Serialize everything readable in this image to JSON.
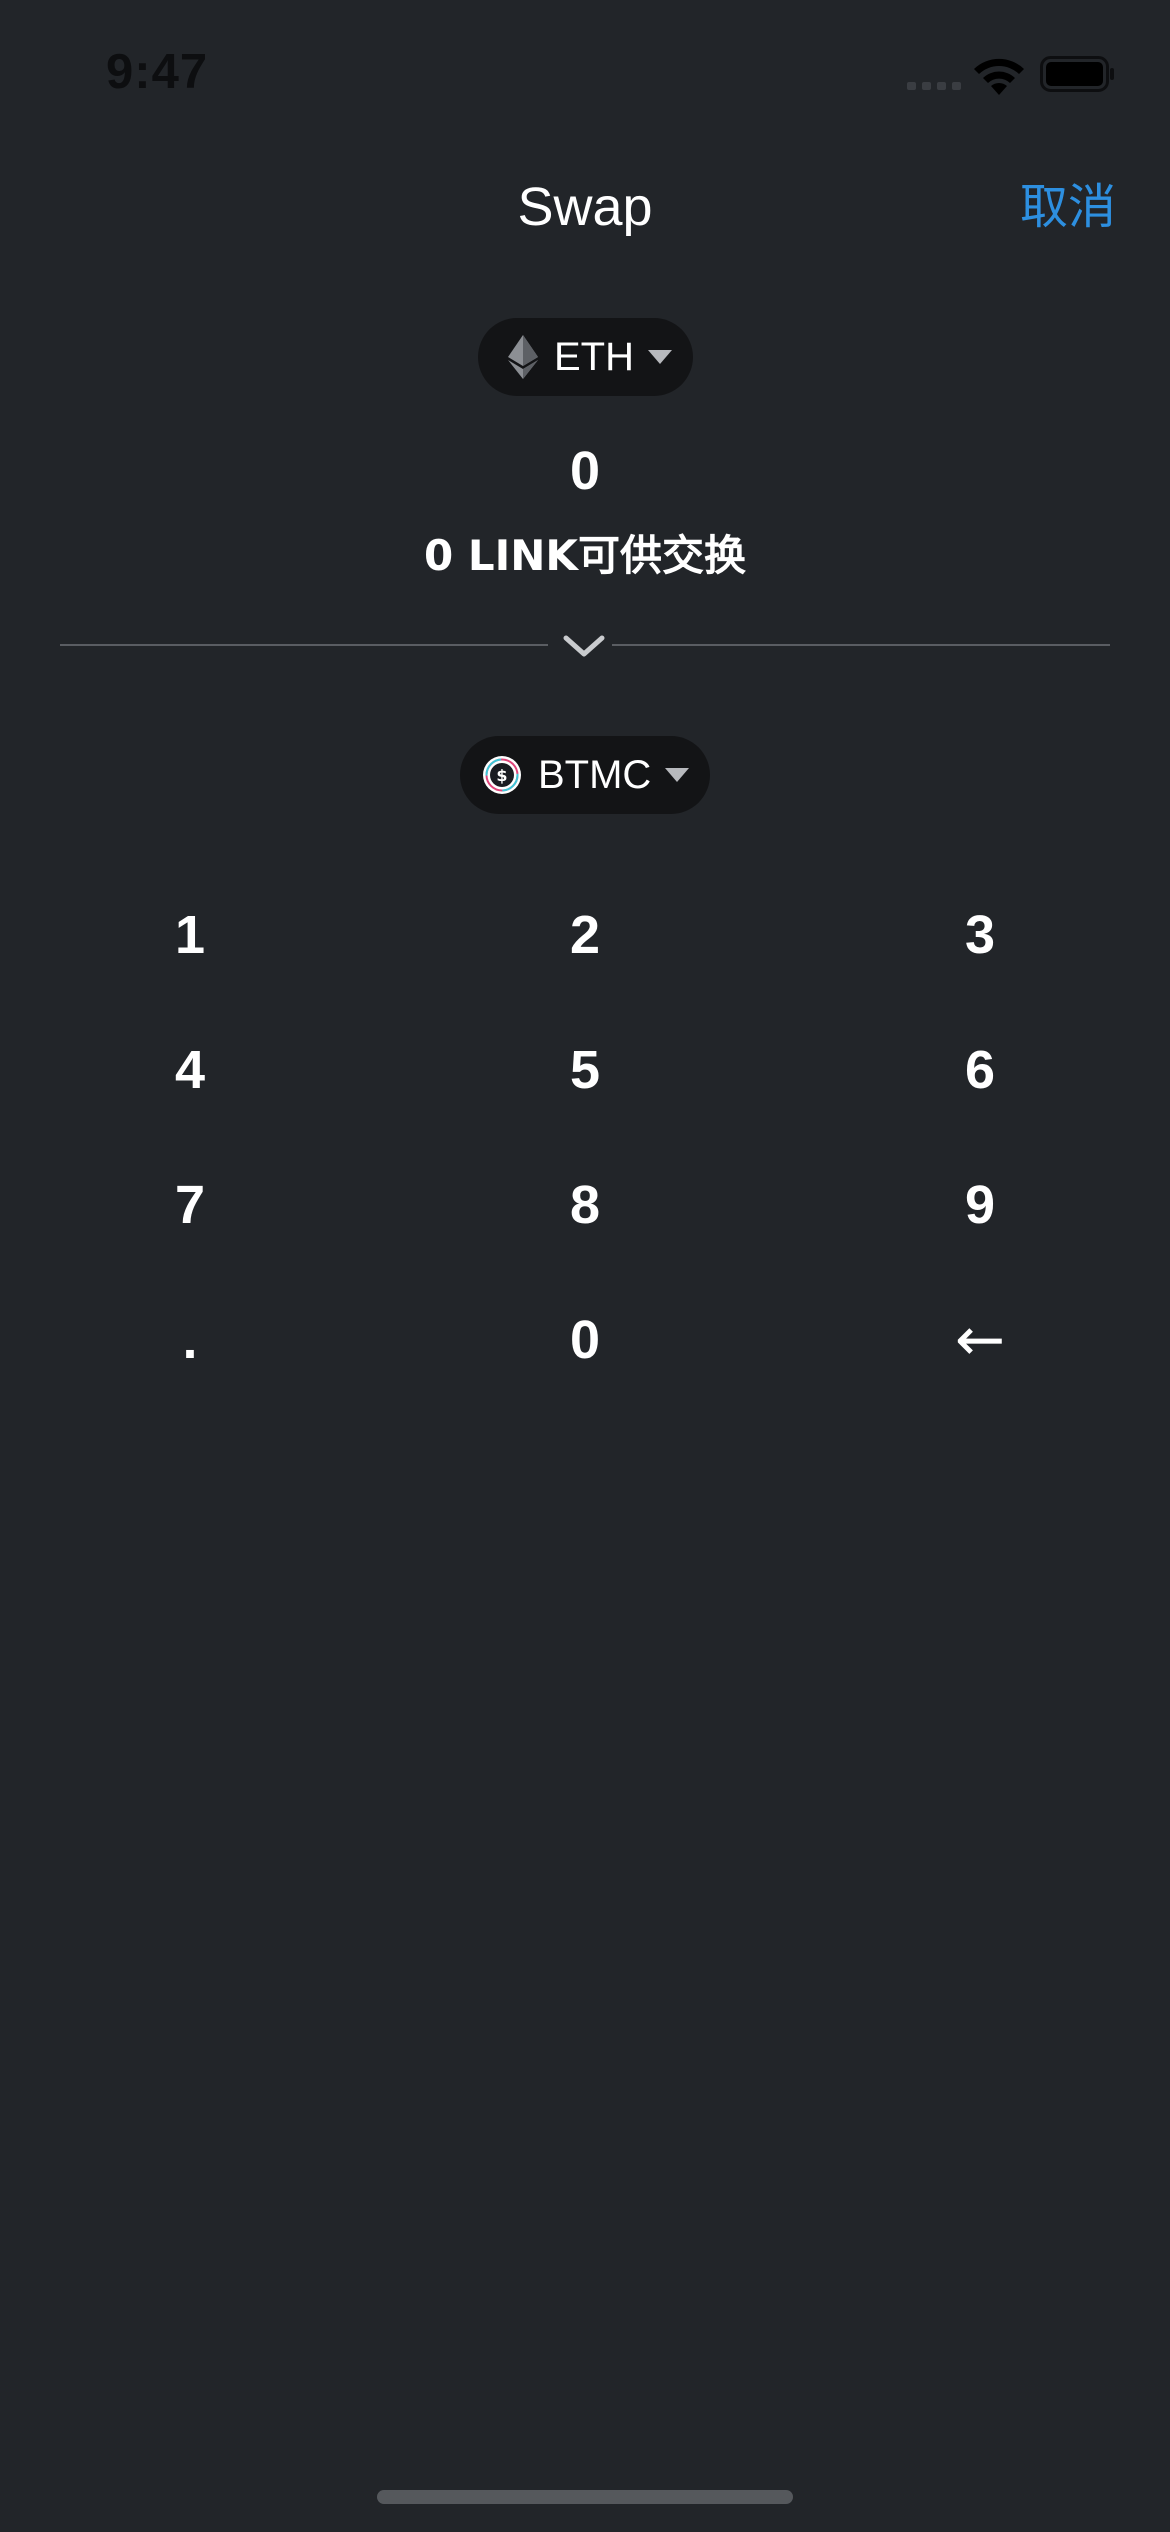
{
  "status_bar": {
    "time": "9:47"
  },
  "header": {
    "title": "Swap",
    "cancel_label": "取消"
  },
  "from_token": {
    "symbol": "ETH",
    "icon": "ethereum-icon"
  },
  "amount": "0",
  "available": "0 LINK可供交换",
  "to_token": {
    "symbol": "BTMC",
    "icon": "btmc-coin-icon"
  },
  "keypad": {
    "keys": [
      "1",
      "2",
      "3",
      "4",
      "5",
      "6",
      "7",
      "8",
      "9",
      ".",
      "0",
      "←"
    ]
  },
  "colors": {
    "background": "#222529",
    "accent": "#2d8fe0",
    "pill": "#131416"
  }
}
